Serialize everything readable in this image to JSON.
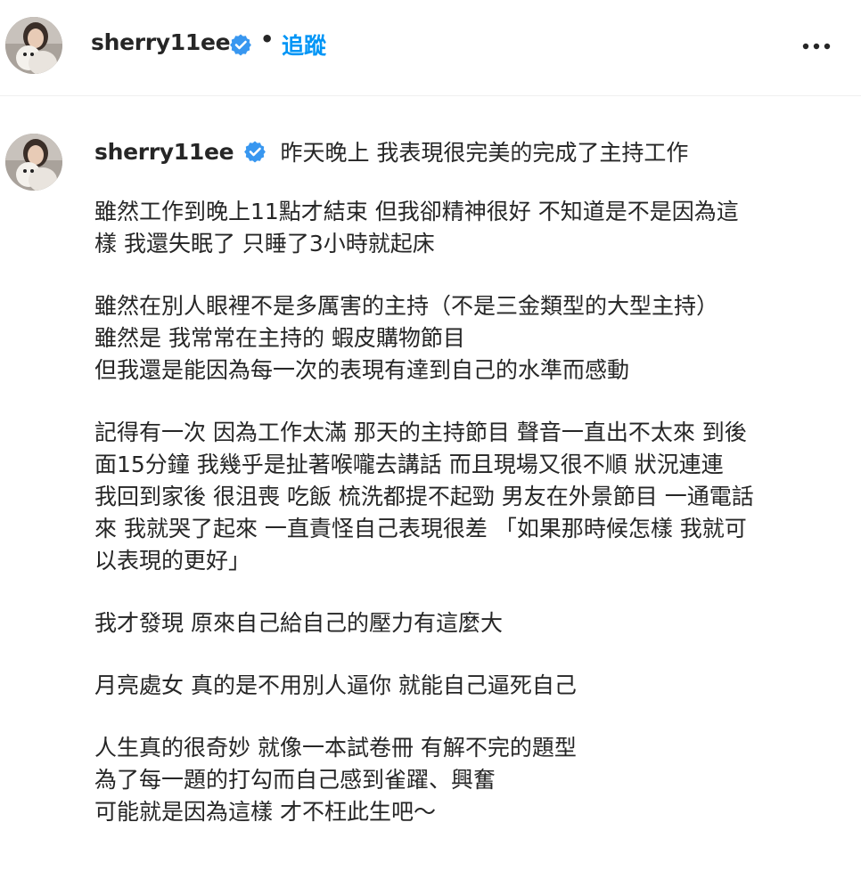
{
  "post": {
    "author": {
      "username": "sherry11ee",
      "verified": true,
      "avatar_icon": "profile-photo-avatar"
    },
    "header": {
      "separator": "•",
      "follow_label": "追蹤",
      "more_icon": "more-horizontal-icon"
    },
    "caption": {
      "first_line": "昨天晚上 我表現很完美的完成了主持工作",
      "paragraphs": [
        [
          "雖然工作到晚上11點才結束 但我卻精神很好 不知道是不是因為這",
          "樣 我還失眠了 只睡了3小時就起床"
        ],
        [
          "雖然在別人眼裡不是多厲害的主持（不是三金類型的大型主持）",
          "雖然是 我常常在主持的 蝦皮購物節目",
          "但我還是能因為每一次的表現有達到自己的水準而感動"
        ],
        [
          "記得有一次 因為工作太滿 那天的主持節目 聲音一直出不太來 到後",
          "面15分鐘 我幾乎是扯著喉嚨去講話 而且現場又很不順 狀況連連",
          "我回到家後 很沮喪 吃飯 梳洗都提不起勁 男友在外景節目 一通電話",
          "來 我就哭了起來 一直責怪自己表現很差 「如果那時候怎樣 我就可",
          "以表現的更好」"
        ],
        [
          "我才發現 原來自己給自己的壓力有這麼大"
        ],
        [
          "月亮處女 真的是不用別人逼你 就能自己逼死自己"
        ],
        [
          "人生真的很奇妙 就像一本試卷冊 有解不完的題型",
          "為了每一題的打勾而自己感到雀躍、興奮",
          "可能就是因為這樣 才不枉此生吧～"
        ]
      ]
    }
  },
  "colors": {
    "text": "#262626",
    "follow": "#0095f6",
    "verified_badge": "#3897f0",
    "divider": "#efefef",
    "background": "#ffffff"
  }
}
